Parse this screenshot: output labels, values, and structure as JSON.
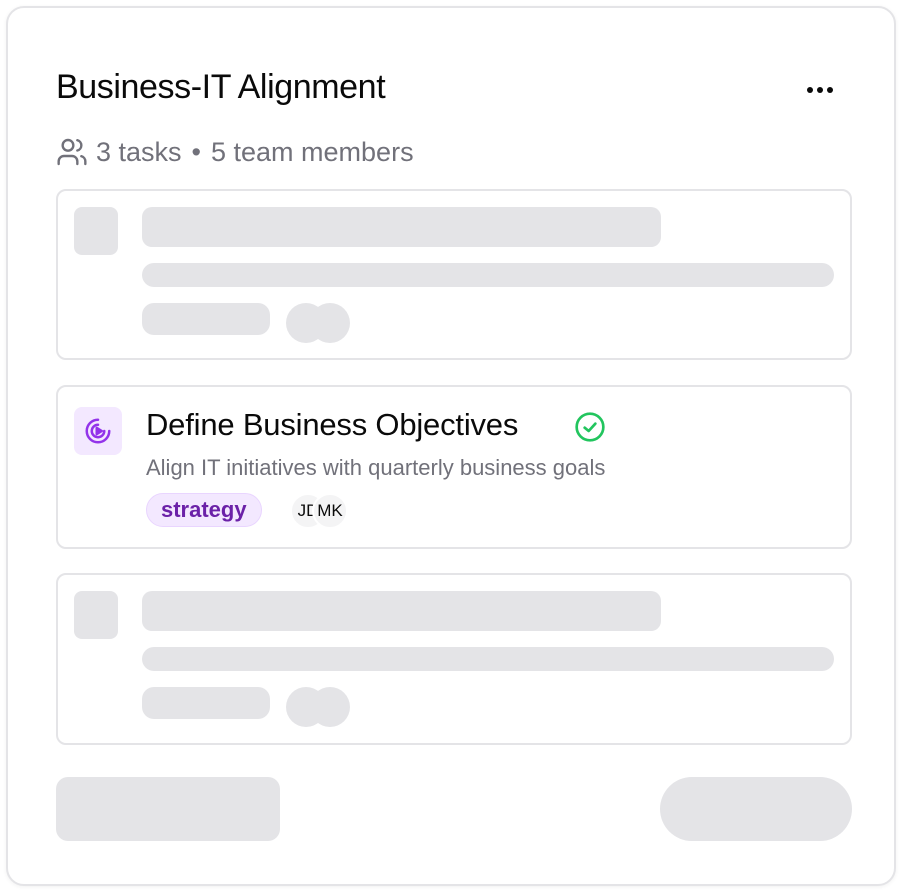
{
  "card": {
    "title": "Business-IT Alignment",
    "menu_icon": "more-horizontal-icon",
    "meta": {
      "icon": "users-icon",
      "tasks": "3 tasks",
      "separator": "•",
      "members": "5 team members"
    }
  },
  "tasks": [
    {
      "state": "loading"
    },
    {
      "state": "loaded",
      "icon": "target-icon",
      "title": "Define Business Objectives",
      "status_icon": "check-circle-icon",
      "description": "Align IT initiatives with quarterly business goals",
      "tag": "strategy",
      "assignees": [
        "JD",
        "MK"
      ]
    },
    {
      "state": "loading"
    }
  ],
  "colors": {
    "skeleton": "#e4e4e7",
    "accent_purple": "#9333ea",
    "tag_bg": "#f3e8ff",
    "tag_text": "#6b21a8",
    "success_green": "#22c55e",
    "muted_text": "#71717a"
  }
}
